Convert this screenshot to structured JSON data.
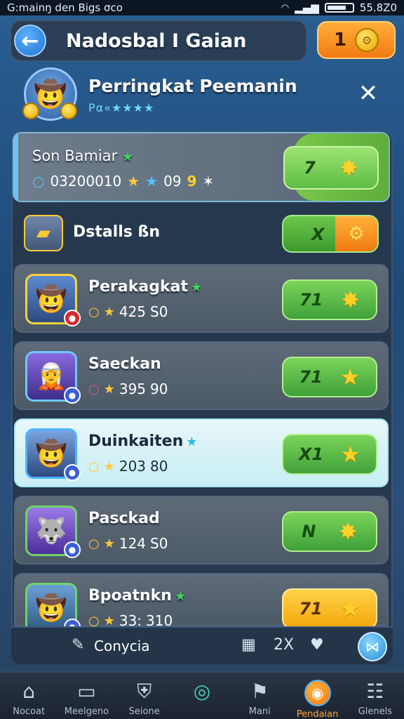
{
  "status": {
    "left": "G:mainŋ den Bigs σco",
    "right": "55.8Z0"
  },
  "topbar": {
    "title": "Nadosbal I Gaian",
    "coins": "1"
  },
  "header": {
    "title": "Perringkat Peemanin",
    "subtitle": "Pα«★★★★"
  },
  "summary": {
    "name": "Son Bamiar",
    "stat1": "03200010",
    "stat2": "09",
    "stat3": "9",
    "score": "7"
  },
  "details": {
    "label": "Dstalls ßn",
    "score": "X"
  },
  "players": [
    {
      "name": "Perakagkat",
      "points": "425",
      "level": "S0",
      "score": "71"
    },
    {
      "name": "Saeckan",
      "points": "395",
      "level": "90",
      "score": "71"
    },
    {
      "name": "Duinkaiten",
      "points": "203",
      "level": "80",
      "score": "X1"
    },
    {
      "name": "Pasckad",
      "points": "124",
      "level": "S0",
      "score": "N"
    },
    {
      "name": "Bpoatnkn",
      "points": "33:",
      "level": "310",
      "score": "71"
    }
  ],
  "toolbar": {
    "label": "Conycia",
    "zoom": "2X"
  },
  "nav": [
    {
      "label": "Nocoat",
      "icon": "home-icon"
    },
    {
      "label": "Meelgeno",
      "icon": "chat-icon"
    },
    {
      "label": "Seione",
      "icon": "shield-icon"
    },
    {
      "label": "",
      "icon": "ring-icon"
    },
    {
      "label": "Mani",
      "icon": "flag-icon"
    },
    {
      "label": "Pendaian",
      "icon": "trophy-icon"
    },
    {
      "label": "Glenels",
      "icon": "settings-icon"
    }
  ],
  "colors": {
    "accent_green": "#5fbd45",
    "accent_orange": "#f27a12",
    "panel_bg": "#26384e",
    "highlight_row": "#d6f3f7"
  }
}
